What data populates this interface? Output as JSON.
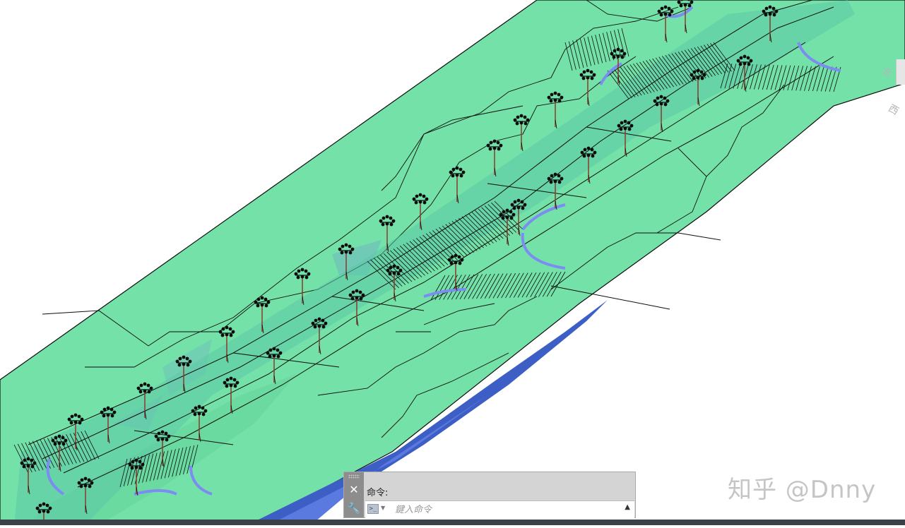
{
  "app": {
    "title": "",
    "watermark": "知乎 @Dnny",
    "viewcube_glyph_top": "北",
    "viewcube_glyph_bottom": "西"
  },
  "drawing": {
    "description_free": true,
    "icons": {
      "tree": "tree-symbol-icon"
    },
    "colors": {
      "terrain": "#74e2a8",
      "terrain_dark": "#5fcf96",
      "road_surface": "#5ac8a0",
      "curb": "#7c8df2",
      "cliff": "#3d5ec4",
      "linework": "#0c0c0c",
      "tree_trunk": "#8a3a2a"
    }
  },
  "command_line": {
    "history": "命令:",
    "placeholder": "鍵入命令",
    "prompt_icon": "command-prompt-icon",
    "close_icon": "close-icon",
    "settings_icon": "wrench-icon",
    "expand_icon": "triangle-up-icon"
  }
}
